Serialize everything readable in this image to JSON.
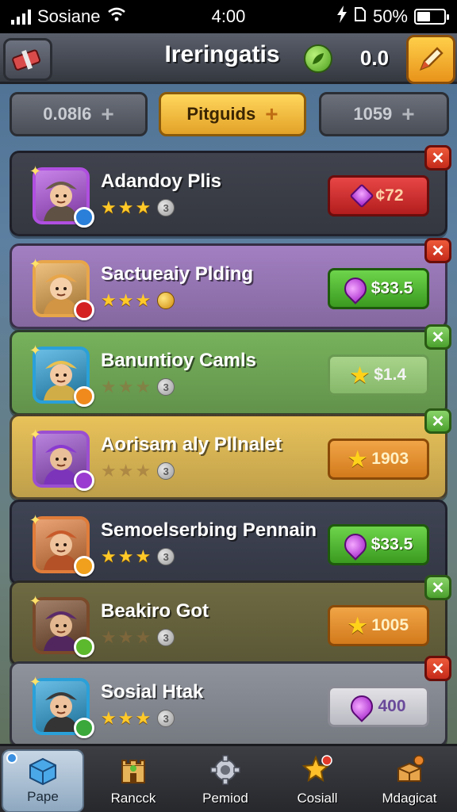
{
  "status_bar": {
    "carrier": "Sosiane",
    "time": "4:00",
    "battery": "50%",
    "battery_level": 0.5
  },
  "top_bar": {
    "title": "Ireringatis",
    "currency_value": "0.0"
  },
  "tabs": [
    {
      "label": "0.08l6",
      "style": "gray"
    },
    {
      "label": "Pitguids",
      "style": "gold"
    },
    {
      "label": "1059",
      "style": "gray"
    }
  ],
  "items": [
    {
      "title": "Adandoy Plis",
      "stars": 3,
      "stars_filled": 3,
      "badge": "3",
      "badge_type": "num",
      "price": "¢72",
      "price_style": "red",
      "price_icon": "diamond",
      "corner": "close",
      "row_color": "#40434d",
      "frame": "#b04fe0",
      "badge_color": "#2a7fd8"
    },
    {
      "title": "Sactueaiy Plding",
      "stars": 3,
      "stars_filled": 3,
      "badge": "",
      "badge_type": "gold",
      "price": "$33.5",
      "price_style": "green",
      "price_icon": "gem",
      "corner": "close",
      "row_color": "#a27fc2",
      "frame": "#e8a64a",
      "badge_color": "#d42222"
    },
    {
      "title": "Banuntioy Camls",
      "stars": 3,
      "stars_filled": 0,
      "badge": "3",
      "badge_type": "num",
      "price": "$1.4",
      "price_style": "light",
      "price_icon": "star",
      "corner": "check",
      "row_color": "#77b25c",
      "frame": "#2aa0d8",
      "badge_color": "#f08a1c"
    },
    {
      "title": "Aorisam aly Pllnalet",
      "stars": 3,
      "stars_filled": 0,
      "badge": "3",
      "badge_type": "num",
      "price": "1903",
      "price_style": "orange",
      "price_icon": "star",
      "corner": "check",
      "row_color": "#e8c25a",
      "frame": "#9b4fd0",
      "badge_color": "#9a3ad0"
    },
    {
      "title": "Semoelserbing Pennain",
      "stars": 3,
      "stars_filled": 3,
      "badge": "3",
      "badge_type": "num",
      "price": "$33.5",
      "price_style": "green",
      "price_icon": "gem",
      "corner": "none",
      "row_color": "#3f4454",
      "frame": "#e07c3a",
      "badge_color": "#f0a01c"
    },
    {
      "title": "Beakiro Got",
      "stars": 3,
      "stars_filled": 0,
      "badge": "3",
      "badge_type": "num",
      "price": "1005",
      "price_style": "orange",
      "price_icon": "star",
      "corner": "check",
      "row_color": "#6e6a42",
      "frame": "#7a4a2a",
      "badge_color": "#5cb82c"
    },
    {
      "title": "Sosial Htak",
      "stars": 3,
      "stars_filled": 3,
      "badge": "3",
      "badge_type": "num",
      "price": "400",
      "price_style": "silver",
      "price_icon": "gem",
      "corner": "close",
      "row_color": "#8f939c",
      "frame": "#2aa0d8",
      "badge_color": "#3aa83a"
    }
  ],
  "nav": [
    {
      "label": "Papе",
      "icon": "cube-icon",
      "active": true
    },
    {
      "label": "Rancck",
      "icon": "castle-icon",
      "active": false
    },
    {
      "label": "Pemiod",
      "icon": "gear-icon",
      "active": false
    },
    {
      "label": "Cosiall",
      "icon": "star-badge-icon",
      "active": false
    },
    {
      "label": "Mdagicat",
      "icon": "treasure-chest-icon",
      "active": false
    }
  ]
}
